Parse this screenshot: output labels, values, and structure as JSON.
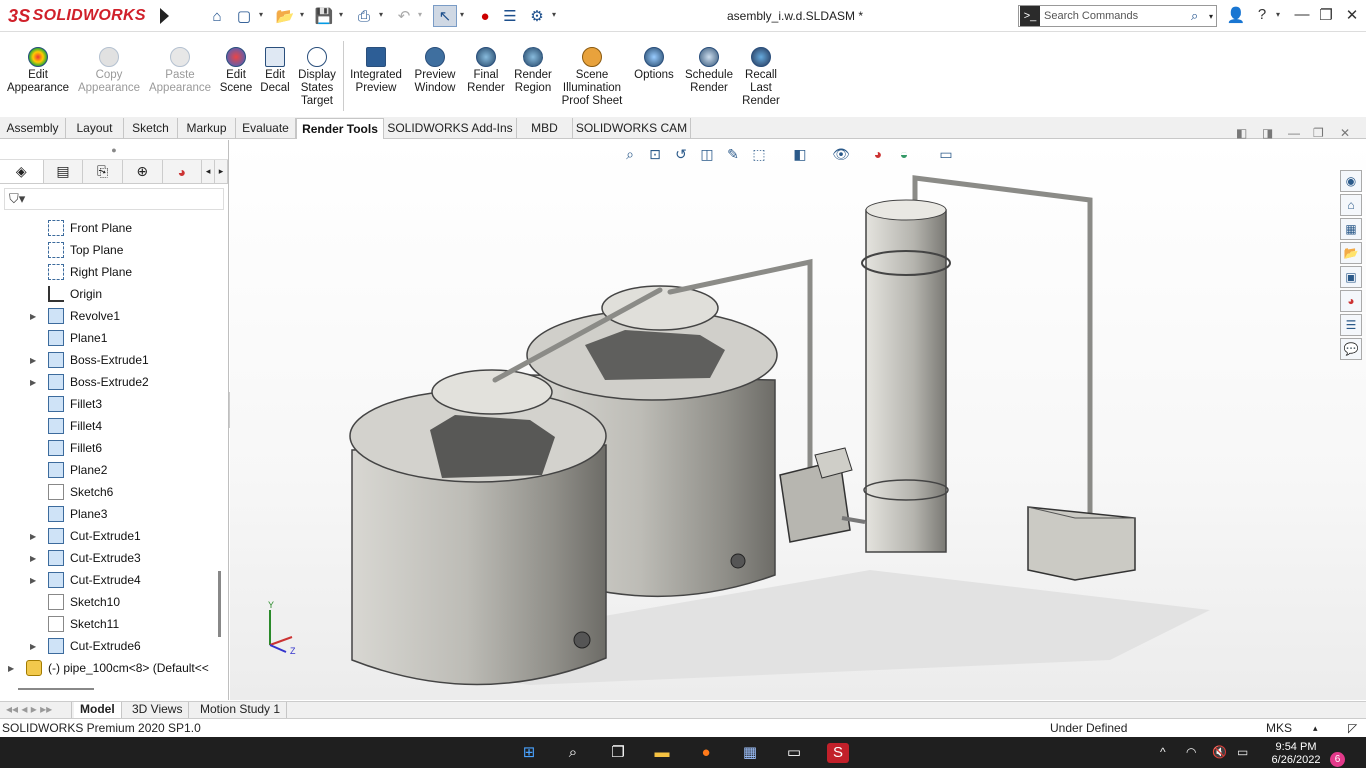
{
  "app": {
    "brand_ds": "3S",
    "brand": "SOLIDWORKS",
    "document_title": "asembly_i.w.d.SLDASM *"
  },
  "search": {
    "placeholder": "Search Commands"
  },
  "ribbon": {
    "buttons": [
      {
        "label": "Edit\nAppearance",
        "enabled": true
      },
      {
        "label": "Copy\nAppearance",
        "enabled": false
      },
      {
        "label": "Paste\nAppearance",
        "enabled": false
      },
      {
        "label": "Edit\nScene",
        "enabled": true
      },
      {
        "label": "Edit\nDecal",
        "enabled": true
      },
      {
        "label": "Display\nStates\nTarget",
        "enabled": true
      },
      {
        "label": "Integrated\nPreview",
        "enabled": true
      },
      {
        "label": "Preview\nWindow",
        "enabled": true
      },
      {
        "label": "Final\nRender",
        "enabled": true
      },
      {
        "label": "Render\nRegion",
        "enabled": true
      },
      {
        "label": "Scene\nIllumination\nProof Sheet",
        "enabled": true
      },
      {
        "label": "Options",
        "enabled": true
      },
      {
        "label": "Schedule\nRender",
        "enabled": true
      },
      {
        "label": "Recall\nLast\nRender",
        "enabled": true
      }
    ]
  },
  "tabs": [
    "Assembly",
    "Layout",
    "Sketch",
    "Markup",
    "Evaluate",
    "Render Tools",
    "SOLIDWORKS Add-Ins",
    "MBD",
    "SOLIDWORKS CAM"
  ],
  "active_tab": "Render Tools",
  "tree": [
    {
      "label": "Front Plane",
      "kind": "plane",
      "expandable": false
    },
    {
      "label": "Top Plane",
      "kind": "plane",
      "expandable": false
    },
    {
      "label": "Right Plane",
      "kind": "plane",
      "expandable": false
    },
    {
      "label": "Origin",
      "kind": "origin",
      "expandable": false
    },
    {
      "label": "Revolve1",
      "kind": "feature",
      "expandable": true
    },
    {
      "label": "Plane1",
      "kind": "feature",
      "expandable": false
    },
    {
      "label": "Boss-Extrude1",
      "kind": "feature",
      "expandable": true
    },
    {
      "label": "Boss-Extrude2",
      "kind": "feature",
      "expandable": true
    },
    {
      "label": "Fillet3",
      "kind": "feature",
      "expandable": false
    },
    {
      "label": "Fillet4",
      "kind": "feature",
      "expandable": false
    },
    {
      "label": "Fillet6",
      "kind": "feature",
      "expandable": false
    },
    {
      "label": "Plane2",
      "kind": "feature",
      "expandable": false
    },
    {
      "label": "Sketch6",
      "kind": "sketch",
      "expandable": false
    },
    {
      "label": "Plane3",
      "kind": "feature",
      "expandable": false
    },
    {
      "label": "Cut-Extrude1",
      "kind": "feature",
      "expandable": true
    },
    {
      "label": "Cut-Extrude3",
      "kind": "feature",
      "expandable": true
    },
    {
      "label": "Cut-Extrude4",
      "kind": "feature",
      "expandable": true
    },
    {
      "label": "Sketch10",
      "kind": "sketch",
      "expandable": false
    },
    {
      "label": "Sketch11",
      "kind": "sketch",
      "expandable": false
    },
    {
      "label": "Cut-Extrude6",
      "kind": "feature",
      "expandable": true
    },
    {
      "label": "(-) pipe_100cm<8> (Default<<",
      "kind": "part",
      "expandable": true
    }
  ],
  "bottom_tabs": [
    "Model",
    "3D Views",
    "Motion Study 1"
  ],
  "active_bottom_tab": "Model",
  "status": {
    "version": "SOLIDWORKS Premium 2020 SP1.0",
    "state": "Under Defined",
    "units": "MKS"
  },
  "triad": {
    "y": "Y",
    "z": "Z"
  },
  "clock": {
    "time": "9:54 PM",
    "date": "6/26/2022"
  },
  "notifications": "6",
  "colors": {
    "brand_red": "#d0202a",
    "tank": "#c9c8c3",
    "taskbar": "#1f1f1f"
  }
}
